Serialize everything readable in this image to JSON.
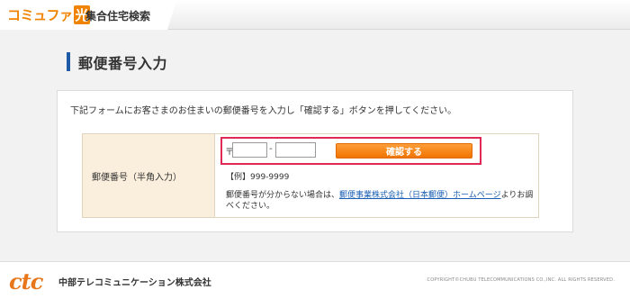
{
  "header": {
    "brand": "コミュファ",
    "brand_hikari": "光",
    "subtitle": "集合住宅検索"
  },
  "page": {
    "title": "郵便番号入力"
  },
  "panel": {
    "instruction": "下記フォームにお客さまのお住まいの郵便番号を入力し「確認する」ボタンを押してください。",
    "label": "郵便番号（半角入力）",
    "zip_mark": "〒",
    "zip_first_value": "",
    "zip_second_value": "",
    "dash": "-",
    "confirm_label": "確認する",
    "example": "【例】999-9999",
    "note_prefix": "郵便番号が分からない場合は、",
    "note_link": "郵便事業株式会社（日本郵便）ホームページ",
    "note_suffix": "よりお調べください。"
  },
  "footer": {
    "logo": "ctc",
    "company": "中部テレコミュニケーション株式会社",
    "copyright": "COPYRIGHT©CHUBU TELECOMMUNICATIONS CO.,INC. ALL RIGHTS RESERVED."
  },
  "colors": {
    "brand_orange": "#f08300",
    "title_bar_blue": "#1f5aa6",
    "button_orange": "#f07400",
    "highlight_red": "#e02a55",
    "label_cell_bg": "#faeedd",
    "link_blue": "#1a5fb4"
  }
}
